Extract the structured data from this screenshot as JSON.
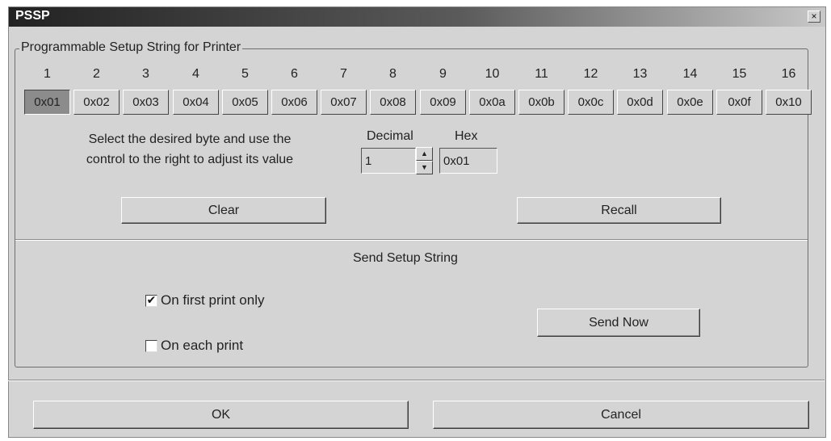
{
  "window": {
    "title": "PSSP",
    "close_glyph": "×"
  },
  "group": {
    "label": "Programmable Setup String for Printer"
  },
  "bytes": [
    {
      "index": "1",
      "value": "0x01",
      "selected": true
    },
    {
      "index": "2",
      "value": "0x02"
    },
    {
      "index": "3",
      "value": "0x03"
    },
    {
      "index": "4",
      "value": "0x04"
    },
    {
      "index": "5",
      "value": "0x05"
    },
    {
      "index": "6",
      "value": "0x06"
    },
    {
      "index": "7",
      "value": "0x07"
    },
    {
      "index": "8",
      "value": "0x08"
    },
    {
      "index": "9",
      "value": "0x09"
    },
    {
      "index": "10",
      "value": "0x0a"
    },
    {
      "index": "11",
      "value": "0x0b"
    },
    {
      "index": "12",
      "value": "0x0c"
    },
    {
      "index": "13",
      "value": "0x0d"
    },
    {
      "index": "14",
      "value": "0x0e"
    },
    {
      "index": "15",
      "value": "0x0f"
    },
    {
      "index": "16",
      "value": "0x10"
    }
  ],
  "instructions": {
    "line1": "Select the desired byte and use the",
    "line2": "control to the right to adjust its value"
  },
  "decimal": {
    "label": "Decimal",
    "value": "1",
    "spin_up_icon": "arrow-up-icon",
    "spin_down_icon": "arrow-down-icon"
  },
  "hex": {
    "label": "Hex",
    "value": "0x01"
  },
  "buttons": {
    "clear": "Clear",
    "recall": "Recall",
    "send_now": "Send Now",
    "ok": "OK",
    "cancel": "Cancel"
  },
  "send": {
    "title": "Send Setup String",
    "first_print_label": "On first print only",
    "first_print_checked": true,
    "each_print_label": "On each print",
    "each_print_checked": false
  },
  "colors": {
    "dialog_bg": "#d4d4d4",
    "selected_byte_bg": "#8c8c8c",
    "titlebar_dark": "#222222"
  }
}
